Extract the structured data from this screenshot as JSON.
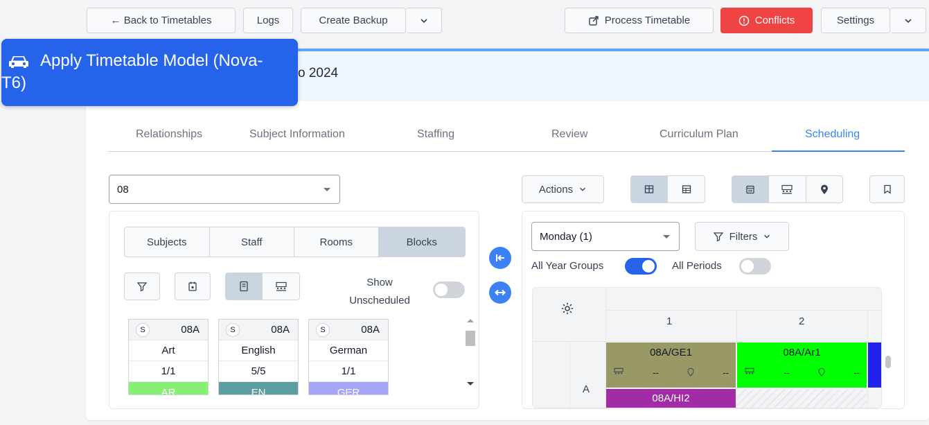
{
  "toolbar": {
    "back": "← Back to Timetables",
    "logs": "Logs",
    "create_backup": "Create Backup",
    "process": "Process Timetable",
    "conflicts": "Conflicts",
    "settings": "Settings"
  },
  "overlay": {
    "title": "Apply Timetable Model (Nova-T6)"
  },
  "banner": {
    "partial": "o 2024"
  },
  "tabs": [
    "Relationships",
    "Subject Information",
    "Staffing",
    "Review",
    "Curriculum Plan",
    "Scheduling"
  ],
  "left": {
    "group_select": "08",
    "segments": [
      "Subjects",
      "Staff",
      "Rooms",
      "Blocks"
    ],
    "show_unscheduled": "Show Unscheduled",
    "cards": [
      {
        "badge": "S",
        "group": "08A",
        "subject": "Art",
        "count": "1/1",
        "code": "AR",
        "color": "#86ef74"
      },
      {
        "badge": "S",
        "group": "08A",
        "subject": "English",
        "count": "5/5",
        "code": "EN",
        "color": "#5f9ea0"
      },
      {
        "badge": "S",
        "group": "08A",
        "subject": "German",
        "count": "1/1",
        "code": "GER",
        "color": "#a5a6f6"
      }
    ]
  },
  "right": {
    "actions": "Actions",
    "day_select": "Monday (1)",
    "filters": "Filters",
    "all_year_groups": "All Year Groups",
    "all_periods": "All Periods",
    "periods": [
      "1",
      "2"
    ],
    "row_label": "A",
    "cells": [
      {
        "title": "08A/GE1",
        "room": "--",
        "loc": "--",
        "color": "#999966"
      },
      {
        "title": "08A/Ar1",
        "room": "--",
        "loc": "--",
        "color": "#00ff00"
      },
      {
        "title": "08A/HI2",
        "color": "#a12ca6"
      }
    ]
  }
}
